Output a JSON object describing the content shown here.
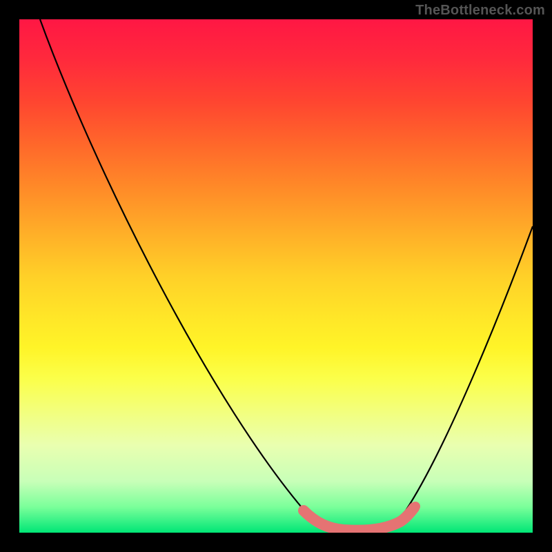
{
  "watermark": "TheBottleneck.com",
  "colors": {
    "frame": "#000000",
    "curve": "#000000",
    "sweet_spot": "#e57373",
    "gradient_top": "#ff1744",
    "gradient_bottom": "#00e676"
  },
  "chart_data": {
    "type": "line",
    "title": "",
    "xlabel": "",
    "ylabel": "",
    "xlim": [
      0,
      100
    ],
    "ylim": [
      0,
      100
    ],
    "series": [
      {
        "name": "bottleneck-curve",
        "x": [
          0,
          8,
          16,
          24,
          32,
          40,
          48,
          55,
          58,
          61,
          64,
          67,
          70,
          73,
          76,
          82,
          88,
          94,
          100
        ],
        "y": [
          100,
          88,
          75,
          63,
          50,
          38,
          25,
          10,
          4,
          1,
          0,
          0,
          1,
          4,
          10,
          24,
          40,
          56,
          72
        ]
      }
    ],
    "annotations": [
      {
        "name": "sweet-spot-band",
        "x_start": 55,
        "x_end": 76,
        "style": "thick-pink-segment"
      }
    ]
  }
}
